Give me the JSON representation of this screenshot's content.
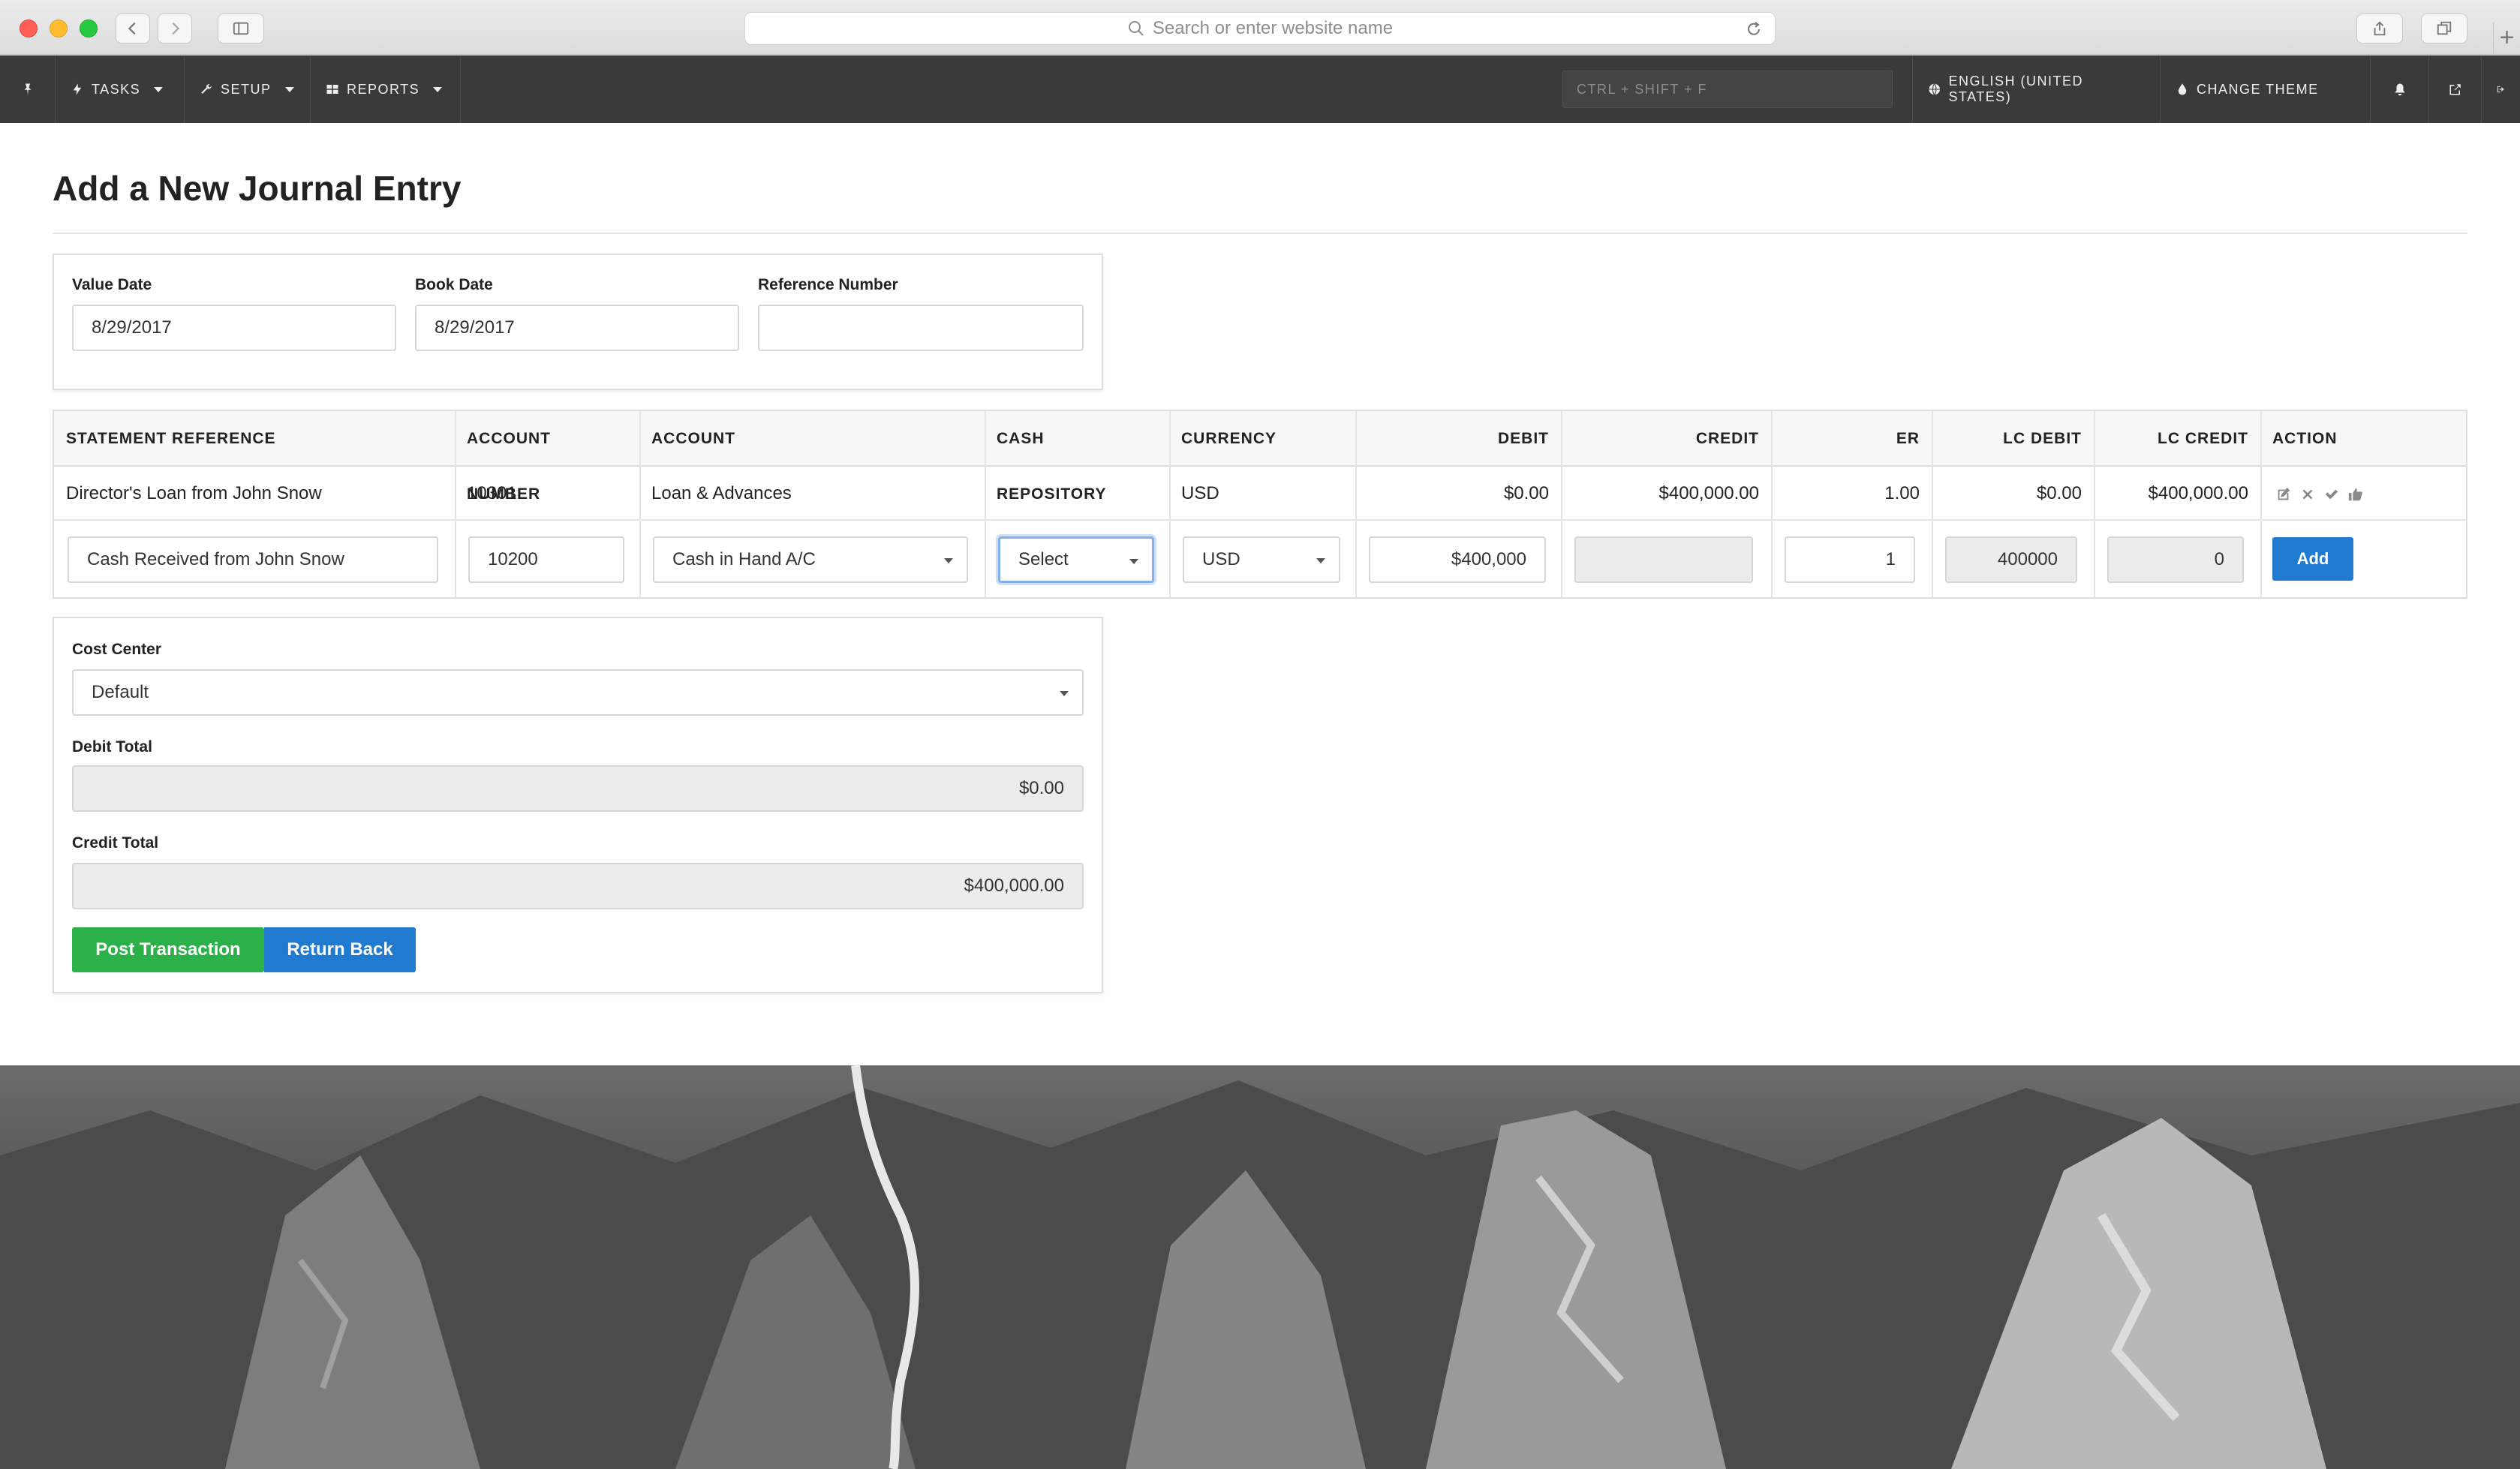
{
  "browser": {
    "url_placeholder": "Search or enter website name"
  },
  "navbar": {
    "tasks": "TASKS",
    "setup": "SETUP",
    "reports": "REPORTS",
    "search_placeholder": "CTRL + SHIFT + F",
    "language": "ENGLISH (UNITED STATES)",
    "theme": "CHANGE THEME"
  },
  "page": {
    "title": "Add a New Journal Entry"
  },
  "header_form": {
    "value_date_label": "Value Date",
    "value_date": "8/29/2017",
    "book_date_label": "Book Date",
    "book_date": "8/29/2017",
    "reference_label": "Reference Number",
    "reference_value": ""
  },
  "table": {
    "columns": [
      "STATEMENT REFERENCE",
      "ACCOUNT NUMBER",
      "ACCOUNT",
      "CASH REPOSITORY",
      "CURRENCY",
      "DEBIT",
      "CREDIT",
      "ER",
      "LC DEBIT",
      "LC CREDIT",
      "ACTION"
    ],
    "rows": [
      {
        "statement_reference": "Director's Loan from John Snow",
        "account_number": "10301",
        "account": "Loan & Advances",
        "cash_repository": "",
        "currency": "USD",
        "debit": "$0.00",
        "credit": "$400,000.00",
        "er": "1.00",
        "lc_debit": "$0.00",
        "lc_credit": "$400,000.00"
      }
    ],
    "entry": {
      "statement_reference": "Cash Received from John Snow",
      "account_number": "10200",
      "account": "Cash in Hand A/C",
      "cash_repository": "Select",
      "currency": "USD",
      "debit": "$400,000",
      "credit": "",
      "er": "1",
      "lc_debit": "400000",
      "lc_credit": "0",
      "add_label": "Add"
    }
  },
  "summary": {
    "cost_center_label": "Cost Center",
    "cost_center": "Default",
    "debit_total_label": "Debit Total",
    "debit_total": "$0.00",
    "credit_total_label": "Credit Total",
    "credit_total": "$400,000.00",
    "post_label": "Post Transaction",
    "return_label": "Return Back"
  },
  "colors": {
    "navbar": "#3a3a3a",
    "primary": "#1f7ad0",
    "success": "#2bb04a"
  }
}
